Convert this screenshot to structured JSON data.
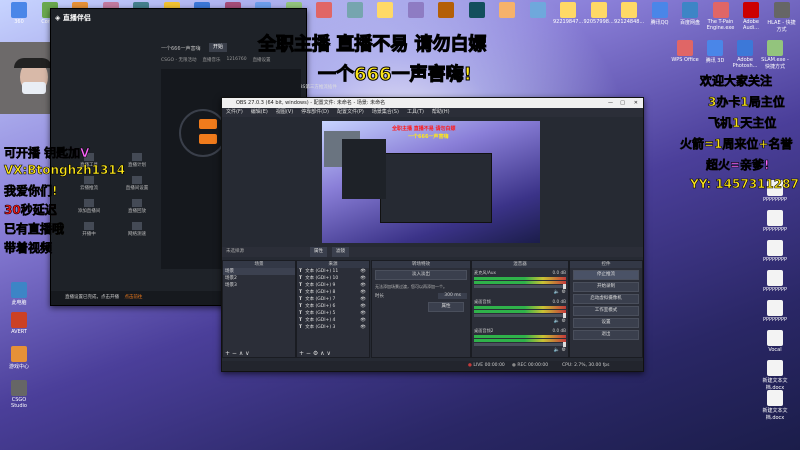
{
  "overlay": {
    "title_line1": "全职主播 直播不易 请勿白嫖",
    "title_line2": "一个666一声害嗨!",
    "left_lines": [
      "可开播 钥匙加V",
      "VX:Btonghzh1314",
      "我爱你们!",
      "30秒延迟",
      "已有直播哦",
      "带着视频"
    ],
    "right_lines": [
      "欢迎大家关注",
      "3办卡1局主位",
      "飞机1天主位",
      "火箭=1周来位+名誉",
      "超火=亲爹!",
      "YY: 1457311287"
    ]
  },
  "desktop": {
    "top_icons": [
      "360",
      "Cortex",
      "",
      "",
      "",
      "",
      "",
      "",
      "",
      "",
      "",
      "",
      "",
      "",
      "",
      "",
      "",
      "",
      "92219847...",
      "92057998...",
      "92124848...",
      "腾讯QQ",
      "百度网盘",
      "The T-Pain Engine.exe",
      "Adobe Audi...",
      "HLAE - 快捷方式"
    ],
    "left_icons": [
      "WPS Office",
      "腾讯 3D",
      "Adobe Photosh...",
      "SLAM.exe - 快捷方式",
      "此电脑",
      "AVERT",
      "游戏中心",
      "CSGO Studio"
    ],
    "right_icons": [
      "PPPPPPPP",
      "PPPPPPPP",
      "PPPPPPPP",
      "PPPPPPPP",
      "PPPPPPPP",
      "Vocal",
      "新建文本文档.docx",
      "新建文本文档.docx"
    ]
  },
  "assistant": {
    "top_label": "一个666一声害嗨",
    "top_button": "开始",
    "tabs": [
      "CSGO - 无限活动",
      "直播音乐",
      "1216760",
      "直播设置"
    ],
    "notice": "OBS第三方推流插件",
    "side_items": [
      "直播工具",
      "直播计划",
      "云播推流",
      "直播间设置",
      "添加直播间",
      "直播回放",
      "开播中",
      "网络测速"
    ],
    "bottom_text": "直播设置已完成，点击开播",
    "bottom_link": "点击前往"
  },
  "obs": {
    "window_title": "OBS 27.0.3 (64 bit, windows) - 配置文件: 未命名 - 场景: 未命名",
    "menu": [
      "文件(F)",
      "编辑(E)",
      "视图(V)",
      "停靠部件(D)",
      "配置文件(P)",
      "场景集合(S)",
      "工具(T)",
      "帮助(H)"
    ],
    "preview_overlay": {
      "line1": "全职主播 直播不易 请勿白嫖",
      "line2": "一个666一声害嗨"
    },
    "source_toolbar": [
      "属性",
      "滤镜"
    ],
    "panels": {
      "scenes": "场景",
      "sources": "来源",
      "transitions": "转场特效",
      "mixer": "混音器",
      "controls": "控件"
    },
    "scene_list": [
      "场景",
      "场景2",
      "场景3"
    ],
    "source_list": [
      "文本 (GDI+) 11",
      "文本 (GDI+) 10",
      "文本 (GDI+) 9",
      "文本 (GDI+) 8",
      "文本 (GDI+) 7",
      "文本 (GDI+) 6",
      "文本 (GDI+) 5",
      "文本 (GDI+) 4",
      "文本 (GDI+) 3"
    ],
    "transition": {
      "select": "淡入淡出",
      "duration_label": "时长",
      "duration_value": "300 ms",
      "note": "无法添加场景过渡，您可以再添加一个。",
      "button": "属性"
    },
    "mixer_tracks": [
      {
        "name": "麦克风/Aux",
        "level": "0.0 dB"
      },
      {
        "name": "桌面音频",
        "level": "0.0 dB"
      },
      {
        "name": "桌面音频2",
        "level": "0.0 dB"
      }
    ],
    "controls": [
      "停止推流",
      "开始录制",
      "启动虚拟摄像机",
      "工作室模式",
      "设置",
      "退出"
    ],
    "status": {
      "live_label": "LIVE",
      "live_time": "00:00:00",
      "rec_label": "REC",
      "rec_time": "00:00:00",
      "cpu": "CPU: 2.7%, 30.00 fps"
    }
  },
  "colors": {
    "overlay_red": "#ff1a1a",
    "overlay_yellow": "#ffe81a",
    "overlay_outline": "#000000",
    "obs_bg": "#262a33",
    "obs_panel": "#2b2e38",
    "meter_green": "#2fb24a",
    "assistant_orange": "#f07b1c"
  }
}
